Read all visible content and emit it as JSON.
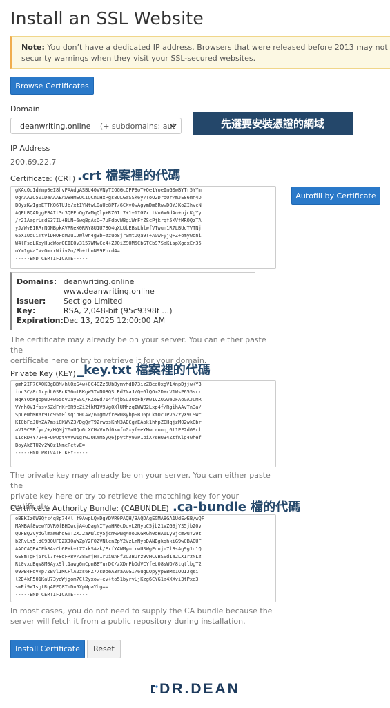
{
  "page": {
    "title": "Install an SSL Website",
    "notice_label": "Note:",
    "notice_line1": "You don’t have a dedicated IP address. Browsers that were released before 2013 may not support",
    "notice_line2": "security warnings when they visit your SSL-secured websites."
  },
  "toolbar": {
    "browse_label": "Browse Certificates"
  },
  "domain": {
    "label": "Domain",
    "selected": "deanwriting.online",
    "selected_suffix": "(+ subdomains: aut",
    "annotation": "先選要安裝憑證的網域"
  },
  "ip": {
    "label": "IP Address",
    "value": "200.69.22.7"
  },
  "certificate": {
    "label": "Certificate: (CRT)",
    "annotation": ".crt 檔案裡的代碼",
    "autofill_label": "Autofill by Certificate",
    "lines": [
      "gKAcQq1dYmp0eI8hvPAAdgASBU40vVNyTIQGGcOPP3oT+Oe1YoeInG0wBYTr5YYm",
      "OgAAAZO501DeAAAEAwBHMEUCIQCnuHxPgs8ULGaSSk6y7ToO2DroOr/mJE86mn4D",
      "BQyzKwIgaETTKQ6TUJb/xtIYNtwLDaUe8PT/6CXv0wAgymDm6RwwDQYJKoZIhvcN",
      "AQELBQADggEBAIt3d3QPEbQg7wMqQlp+RZ6Ir7+1+1IG7xrtVu6x6dAn+njcKgYy",
      "/r21AagrLsdS37IU+BLN+6wqBgAsD+7uFdbvWBgiWrFfZScPjkrqf5KVfMROQzTA",
      "yJzWvE1RRrNQNBpkAVPReX0RRY8U1U78O4qXLUbEBsLhlwfVTwun1R7LBUcTVTNj",
      "65X1UouiTtviDHOFqMZu1JWl0n4g3b+zzuo8jr0MtDQa9T+AGwFyjQFZ+omywqni",
      "W4lFsoLKpyHucWorQEIEQv3157WMvCe4+ZJOiZSOM5CbGTCb97SaKispXgdxEn35",
      "oYm1gVaIVvOmrrWiivZm/Ph+thnN99Fbxd4=",
      "-----END CERTIFICATE-----"
    ],
    "help_line1": "The certificate may already be on your server. You can either paste the",
    "help_line2": "certificate here or try to retrieve it for your domain."
  },
  "cert_info": {
    "domains_label": "Domains:",
    "domains": [
      "deanwriting.online",
      "www.deanwriting.online"
    ],
    "issuer_label": "Issuer:",
    "issuer": "Sectigo Limited",
    "key_label": "Key:",
    "key": "RSA, 2,048-bit (95c9398f …)",
    "expiration_label": "Expiration:",
    "expiration": "Dec 13, 2025 12:00:00 AM"
  },
  "private_key": {
    "label": "Private Key (KEY)",
    "annotation": "_key.txt 檔案裡的代碼",
    "lines": [
      "gmh2IP7CAQKBgBBM/hlOxG4w+0C4GZz6UbBymvhdD73izZBee0xgV1XnpDjjw+Y3",
      "iuc3C/8r1xydL0SBnK56mtRKgW5TvNO8QScRd7NaJ/Q+6lQOm2D+cV1WsP655srr",
      "HqKYOqKgopWD+w55qvDaySSC/RZoEd714f4jbSu30oFb/Ww1vZOGweDFAoGAJuMR",
      "VYnhQVIfssv5ZdFnKr8R9cZi2fkM1V9VgOXlUMhzqIWWB2Lxp4f/RgihAAvTn3a/",
      "SpueWbMRar9Ic95t0lsqin0CAw/6IgM7frew08ybpSBJ6pCkm0cJPv52zyX9CSWc",
      "KI0bFoJUhZA7msi8KWNZ3/DgQrT92rwosKnM3AECgYEAok1hhpZEHqjzM02wkObr",
      "aV19C9Bfyc/+/HQMjY6uUQo6cXCHwVuZd0kmfnGxyf+eYMwcronqj6t1PF2d09rl",
      "LIcRD+Y72+eFUPUgtvXVw1grwJOKYM5yQ6jpythy9VP1biX76HU34ZtfKlg4whef",
      "BoyAk6TU2v2WOz1NmcPctvE=",
      "-----END PRIVATE KEY-----"
    ],
    "help_line1": "The private key may already be on your server. You can either paste the",
    "help_line2": "private key here or try to retrieve the matching key for your certificate."
  },
  "cabundle": {
    "label": "Certificate Authority Bundle: (CABUNDLE)",
    "annotation": ".ca-bundle 檔的代碼",
    "lines": [
      "oBEKIz6WBQfs4q8p74Kl f9AwpLQxDgYDVR0PAQH/BAQDAgEGMA8GA1UdEwEB/wQF",
      "MAMBAf8wewYDVR0fBHQwcjA4oDagNIYyaHR0cDovL2NybC5jb21vZG9jYS5jb20v",
      "QUFBQ2VydGlmaWNhdGVTZXJ2aWNlcy5jcmwwNqA0oDKGMGh0dHA6Ly9jcmwuY29t",
      "b2RvLm5ldC9BQUFDZXJ0aWZpY2F0ZVNlcnZpY2VzLmNybDANBgkqhkiG9w0BAQUF",
      "AAOCAQEACFb8AvCb6P+k+tZ7xkSAzk/ExfYAWMymtrwUSWgEdujm7l3sAg9g1o1Q",
      "GE8mTgHj5rCl7r+8dFR8v/38ErjHT1rOiWAFf2C3BUrz9vHCvBSSdIa2LX1rzNLz",
      "Rt0vxuBqw8M0Ayx9lt1awg6nCpnBBYurDC/zXDrPbDdVCYfeU08sWO/8tqtlbgT2",
      "09wB4FoVxp7ZBVlIMCFlA2zs6FZ77sDoeA3raAVGI/6ugLOpyypEBMs1OUIJqsi",
      "l2D4kF501KaU73yqWjgom7Cl2yxow+ev+to51byrvLjKzg6CYG1a4XXvi3tPxq3",
      "smPi9WIsgtRqAEFQ8TmDn5XpNpaYbg==",
      "-----END CERTIFICATE-----"
    ],
    "help_line1": "In most cases, you do not need to supply the CA bundle because the",
    "help_line2": "server will fetch it from a public repository during installation."
  },
  "actions": {
    "install_label": "Install Certificate",
    "reset_label": "Reset"
  },
  "brand": {
    "logo_text": "DR.DEAN"
  },
  "colors": {
    "accent": "#2a79c9",
    "annotation": "#24476a",
    "notice_bg": "#fcf8e3"
  }
}
